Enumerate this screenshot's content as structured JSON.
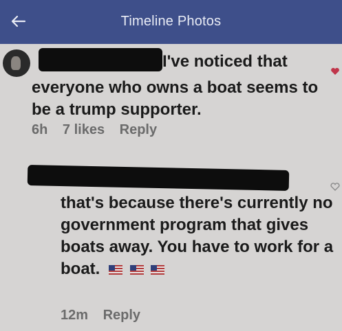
{
  "header": {
    "title": "Timeline Photos",
    "back_icon": "arrow-left-icon"
  },
  "comments": [
    {
      "line1": "I've noticed that",
      "body": "everyone who owns a boat seems to be a trump supporter.",
      "time": "6h",
      "likes": "7 likes",
      "reply": "Reply"
    },
    {
      "body": "that's because there's currently no government program that gives boats away. You have to work for a boat.",
      "time": "12m",
      "reply": "Reply"
    }
  ]
}
